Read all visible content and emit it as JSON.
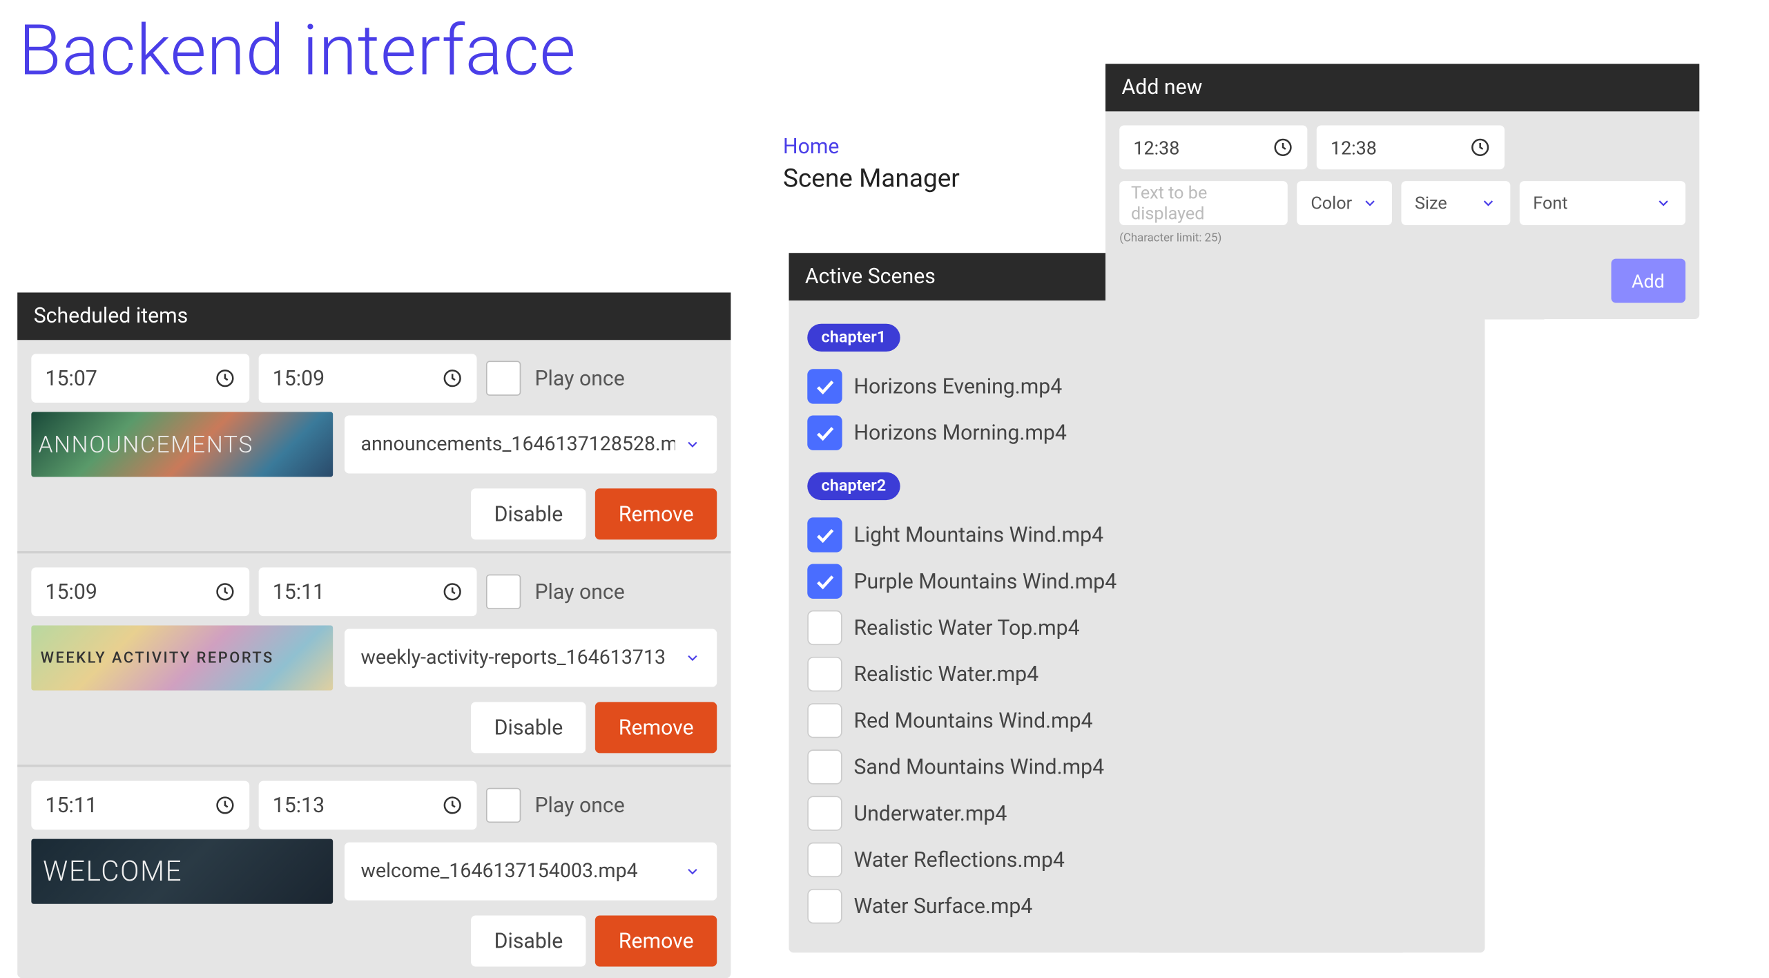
{
  "page_title": "Backend interface",
  "breadcrumb": {
    "home_label": "Home"
  },
  "scene_manager": {
    "title": "Scene Manager"
  },
  "scheduled": {
    "header": "Scheduled items",
    "play_once_label": "Play once",
    "disable_label": "Disable",
    "remove_label": "Remove",
    "items": [
      {
        "start": "15:07",
        "end": "15:09",
        "filename": "announcements_1646137128528.m",
        "thumb_text": "ANNOUNCEMENTS",
        "thumb_class": "thumb-announce"
      },
      {
        "start": "15:09",
        "end": "15:11",
        "filename": "weekly-activity-reports_164613713",
        "thumb_text": "WEEKLY ACTIVITY REPORTS",
        "thumb_class": "thumb-weekly"
      },
      {
        "start": "15:11",
        "end": "15:13",
        "filename": "welcome_1646137154003.mp4",
        "thumb_text": "WELCOME",
        "thumb_class": "thumb-welcome"
      }
    ]
  },
  "scenes": {
    "header": "Active Scenes",
    "chapters": [
      {
        "badge": "chapter1",
        "items": [
          {
            "name": "Horizons Evening.mp4",
            "checked": true
          },
          {
            "name": "Horizons Morning.mp4",
            "checked": true
          }
        ]
      },
      {
        "badge": "chapter2",
        "items": [
          {
            "name": "Light Mountains Wind.mp4",
            "checked": true
          },
          {
            "name": "Purple Mountains Wind.mp4",
            "checked": true
          },
          {
            "name": "Realistic Water Top.mp4",
            "checked": false
          },
          {
            "name": "Realistic Water.mp4",
            "checked": false
          },
          {
            "name": "Red Mountains Wind.mp4",
            "checked": false
          },
          {
            "name": "Sand Mountains Wind.mp4",
            "checked": false
          },
          {
            "name": "Underwater.mp4",
            "checked": false
          },
          {
            "name": "Water Reflections.mp4",
            "checked": false
          },
          {
            "name": "Water Surface.mp4",
            "checked": false
          }
        ]
      }
    ]
  },
  "addnew": {
    "header": "Add new",
    "time1": "12:38",
    "time2": "12:38",
    "text_placeholder": "Text to be displayed",
    "color_label": "Color",
    "size_label": "Size",
    "font_label": "Font",
    "char_limit": "(Character limit: 25)",
    "add_label": "Add"
  }
}
